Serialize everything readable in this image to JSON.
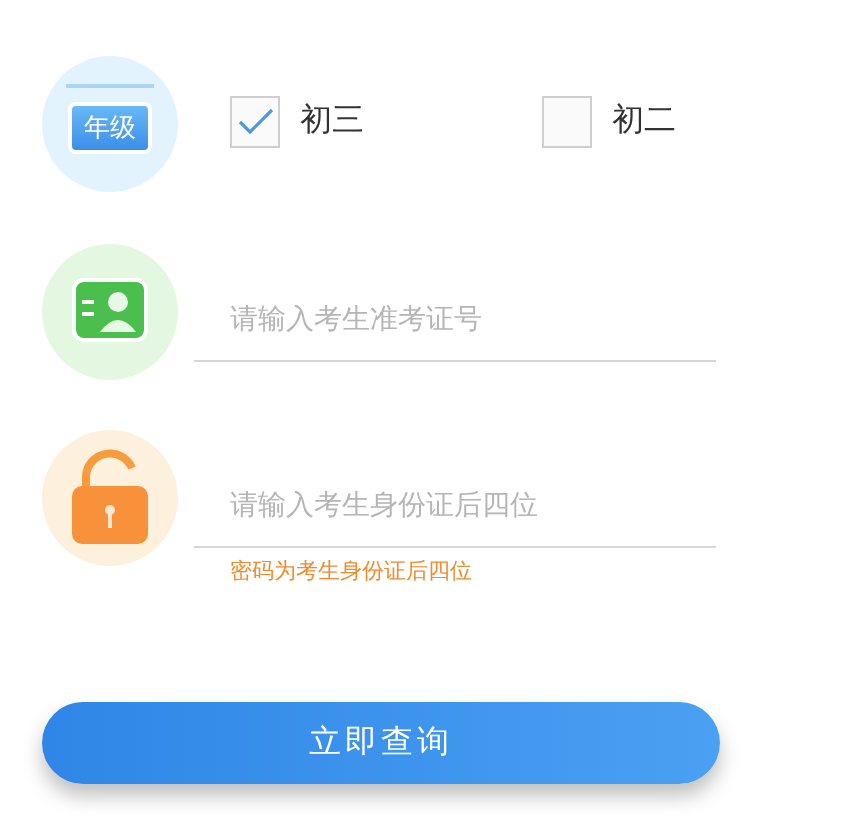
{
  "grade": {
    "icon_label": "年级",
    "options": [
      {
        "label": "初三",
        "checked": true
      },
      {
        "label": "初二",
        "checked": false
      }
    ]
  },
  "exam_number": {
    "placeholder": "请输入考生准考证号"
  },
  "password": {
    "placeholder": "请输入考生身份证后四位",
    "hint": "密码为考生身份证后四位"
  },
  "submit": {
    "label": "立即查询"
  }
}
